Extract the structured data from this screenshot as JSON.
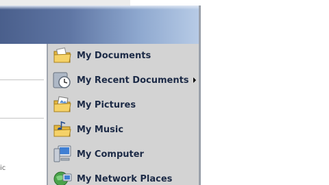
{
  "start_menu": {
    "left_cut_text": "ic",
    "places": [
      {
        "label": "My Documents",
        "icon": "folder-documents-icon"
      },
      {
        "label": "My Recent Documents",
        "icon": "recent-documents-icon",
        "submenu": true
      },
      {
        "label": "My Pictures",
        "icon": "folder-pictures-icon"
      },
      {
        "label": "My Music",
        "icon": "folder-music-icon"
      },
      {
        "label": "My Computer",
        "icon": "computer-icon"
      },
      {
        "label": "My Network Places",
        "icon": "network-places-icon"
      }
    ]
  },
  "colors": {
    "header_start": "#4a5f8c",
    "header_end": "#b7cbe6",
    "places_background": "#d3d3d3",
    "label_text": "#1c2a46"
  }
}
